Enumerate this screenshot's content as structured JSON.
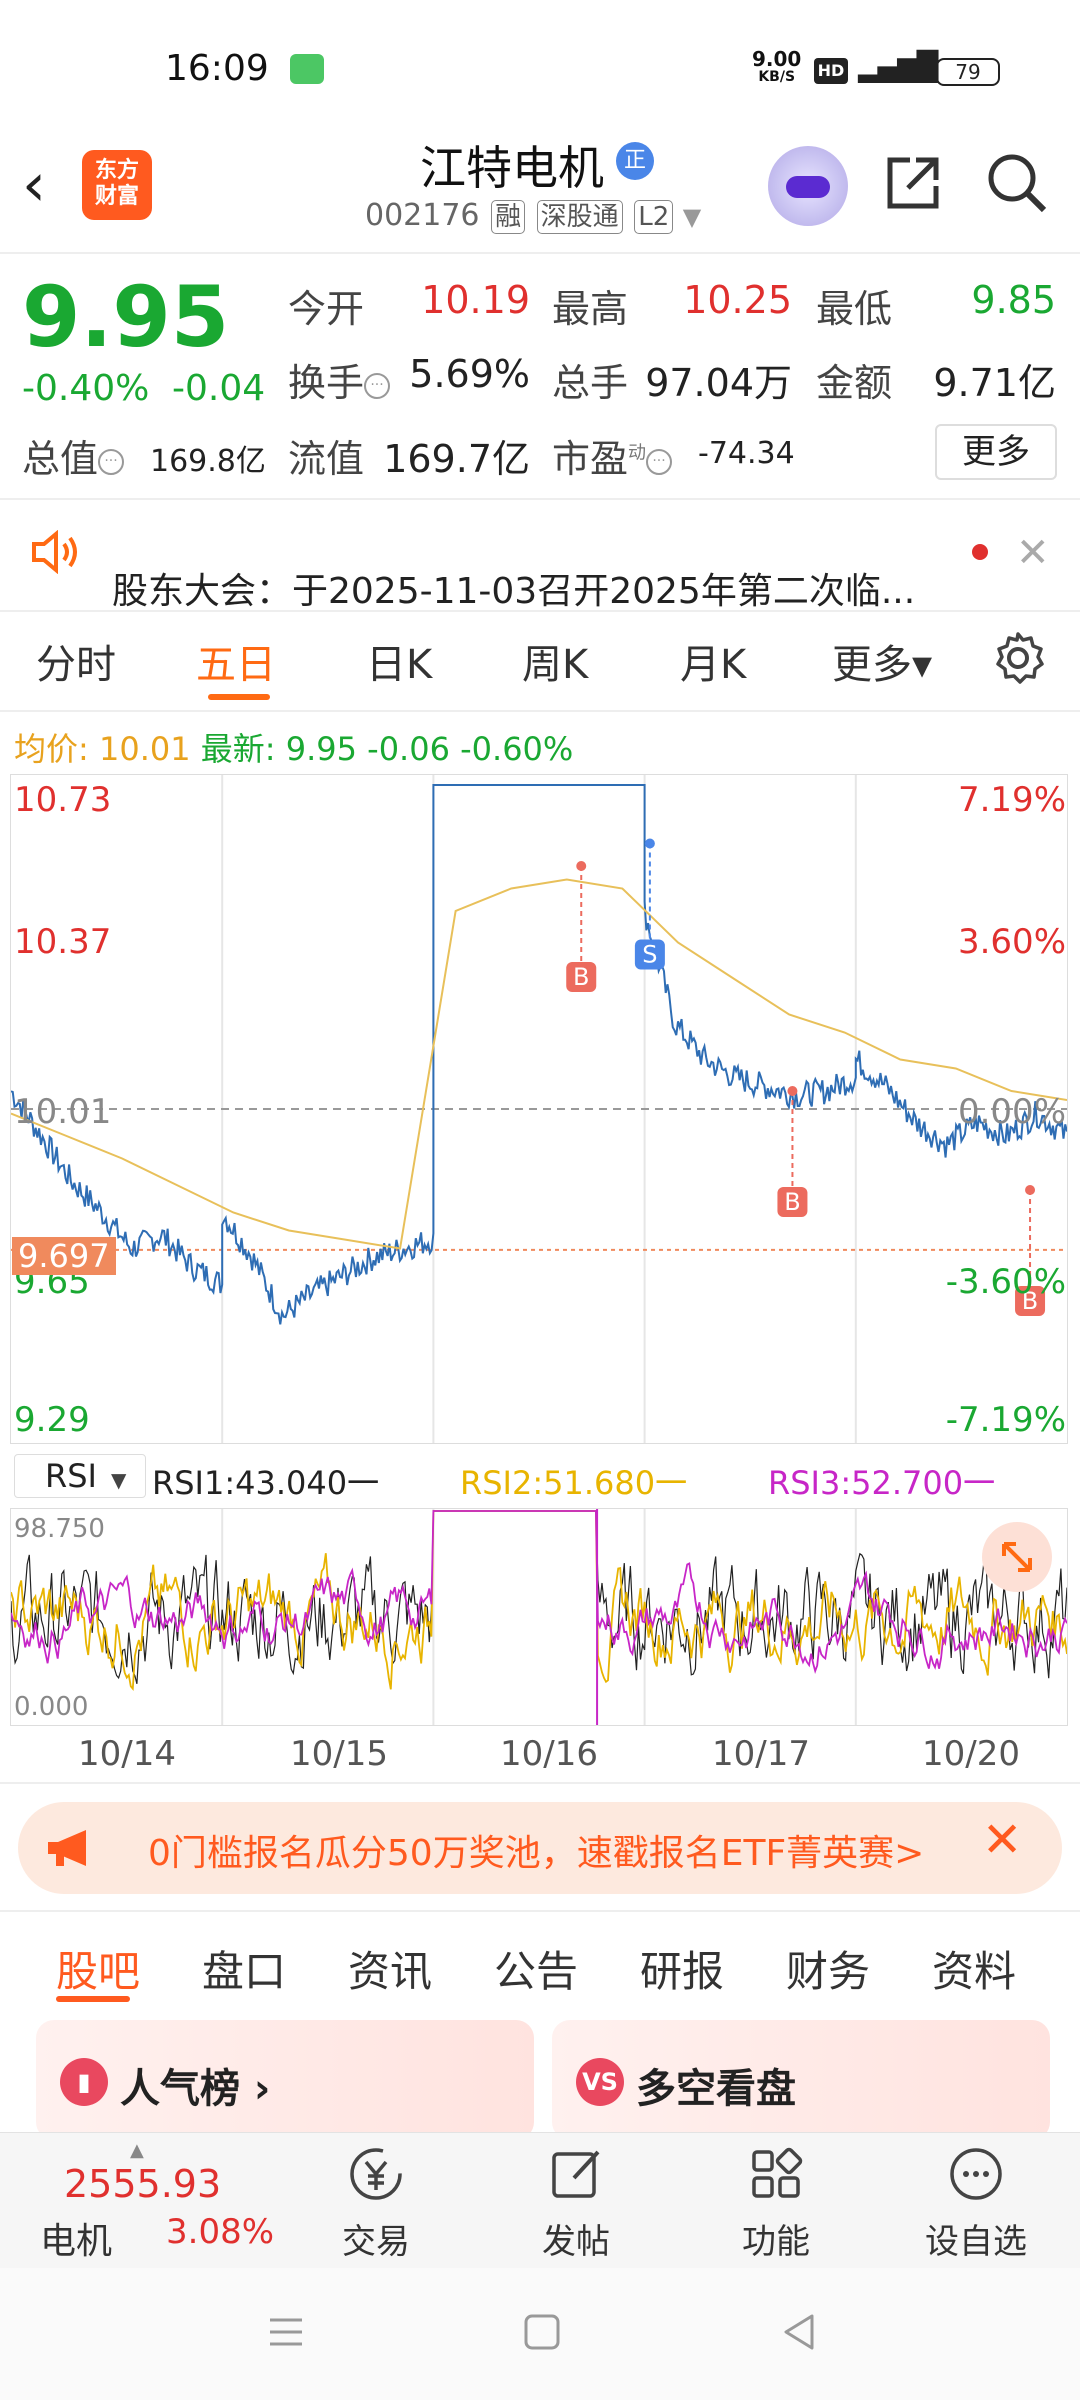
{
  "status_bar": {
    "time": "16:09",
    "net_speed": "9.00",
    "net_unit": "KB/S",
    "hd": "HD",
    "signal": "⁵ᴳ📶",
    "battery": "79"
  },
  "header": {
    "logo_line1": "东方",
    "logo_line2": "财富",
    "title": "江特电机",
    "verified": "正",
    "code": "002176",
    "tags": [
      "融",
      "深股通",
      "L2"
    ]
  },
  "quote": {
    "price": "9.95",
    "change_pct": "-0.40%",
    "change": "-0.04",
    "open_label": "今开",
    "open": "10.19",
    "high_label": "最高",
    "high": "10.25",
    "low_label": "最低",
    "low": "9.85",
    "turnover_label": "换手",
    "turnover": "5.69%",
    "volume_label": "总手",
    "volume": "97.04万",
    "amount_label": "金额",
    "amount": "9.71亿",
    "mktcap_label": "总值",
    "mktcap": "169.8亿",
    "float_label": "流值",
    "float": "169.7亿",
    "pe_label": "市盈",
    "pe_sup": "动",
    "pe": "-74.34",
    "more": "更多"
  },
  "notice": {
    "text": "股东大会：于2025-11-03召开2025年第二次临..."
  },
  "kline_tabs": [
    "分时",
    "五日",
    "日K",
    "周K",
    "月K",
    "更多▾"
  ],
  "legend": {
    "avg_label": "均价:",
    "avg": "10.01",
    "latest_label": "最新:",
    "latest": "9.95",
    "chg": "-0.06",
    "chg_pct": "-0.60%"
  },
  "chart": {
    "y_left": [
      "10.73",
      "10.37",
      "10.01",
      "9.65",
      "9.29"
    ],
    "y_right": [
      "7.19%",
      "3.60%",
      "0.00%",
      "-3.60%",
      "-7.19%"
    ],
    "cursor_price": "9.697",
    "markers": [
      "B",
      "S",
      "B",
      "B"
    ]
  },
  "rsi": {
    "selector": "RSI",
    "rsi1": "RSI1:43.040一",
    "rsi2": "RSI2:51.680一",
    "rsi3": "RSI3:52.700一",
    "max": "98.750",
    "min": "0.000"
  },
  "x_dates": [
    "10/14",
    "10/15",
    "10/16",
    "10/17",
    "10/20"
  ],
  "colors": {
    "up": "#e0302e",
    "down": "#1aa832",
    "accent": "#ff6a13",
    "price_line": "#2e6db4",
    "avg_line": "#e8c05a"
  },
  "banner": {
    "text": "0门槛报名瓜分50万奖池，速戳报名ETF菁英赛>"
  },
  "section_tabs": [
    "股吧",
    "盘口",
    "资讯",
    "公告",
    "研报",
    "财务",
    "资料"
  ],
  "cards": [
    {
      "label": "人气榜 ›"
    },
    {
      "label": "多空看盘"
    }
  ],
  "bottom_nav": {
    "index_value": "2555.93",
    "index_name": "电机",
    "index_pct": "3.08%",
    "items": [
      "交易",
      "发帖",
      "功能",
      "设自选"
    ]
  },
  "chart_data": {
    "type": "line",
    "title": "",
    "x": [
      "10/14",
      "10/15",
      "10/16",
      "10/17",
      "10/20"
    ],
    "series": [
      {
        "name": "",
        "values": [
          10.05,
          9.55,
          10.73,
          10.08,
          9.95
        ]
      },
      {
        "name": "均价",
        "values": [
          9.98,
          9.75,
          10.45,
          10.15,
          10.01
        ]
      }
    ],
    "ylim": [
      9.29,
      10.73
    ],
    "xlabel": "",
    "ylabel": ""
  }
}
